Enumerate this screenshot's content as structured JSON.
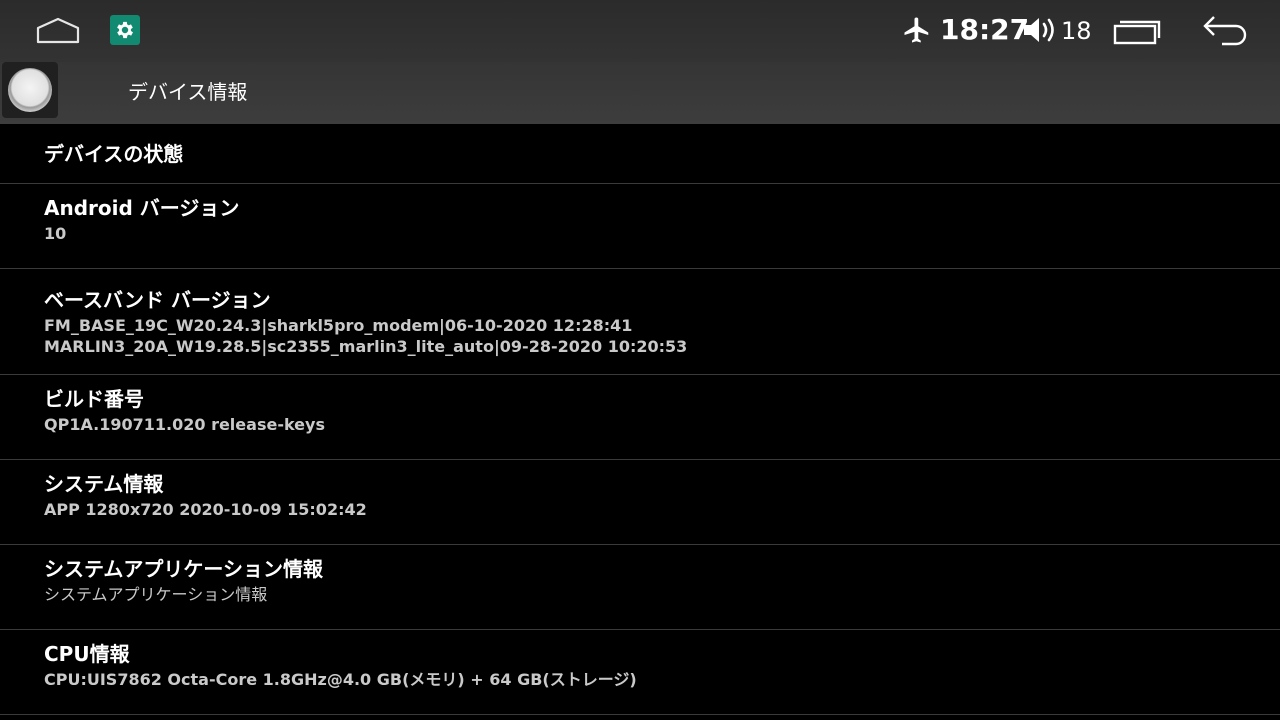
{
  "status_bar": {
    "time": "18:27",
    "volume_level": "18",
    "icons": {
      "home": "home-icon",
      "settings_app": "gear-icon",
      "airplane": "airplane-mode-icon",
      "volume": "speaker-icon",
      "recents": "recent-apps-icon",
      "back": "back-arrow-icon"
    }
  },
  "title_bar": {
    "title": "デバイス情報",
    "menu_icon": "round-menu-button-icon"
  },
  "list": {
    "section_header": "デバイスの状態",
    "items": [
      {
        "title": "Android バージョン",
        "lines": [
          "10"
        ]
      },
      {
        "title": "ベースバンド バージョン",
        "lines": [
          "FM_BASE_19C_W20.24.3|sharkl5pro_modem|06-10-2020 12:28:41",
          "MARLIN3_20A_W19.28.5|sc2355_marlin3_lite_auto|09-28-2020 10:20:53"
        ]
      },
      {
        "title": "ビルド番号",
        "lines": [
          "QP1A.190711.020 release-keys"
        ]
      },
      {
        "title": "システム情報",
        "lines": [
          "APP 1280x720 2020-10-09 15:02:42"
        ]
      },
      {
        "title": "システムアプリケーション情報",
        "lines": [
          "システムアプリケーション情報"
        ]
      },
      {
        "title": "CPU情報",
        "lines": [
          "CPU:UIS7862 Octa-Core 1.8GHz@4.0 GB(メモリ) + 64 GB(ストレージ)"
        ]
      }
    ]
  },
  "colors": {
    "background": "#000000",
    "bar": "#333333",
    "settings_icon_bg": "#128a71",
    "subtext": "#c9c9c9",
    "divider": "#3a3a3a"
  }
}
